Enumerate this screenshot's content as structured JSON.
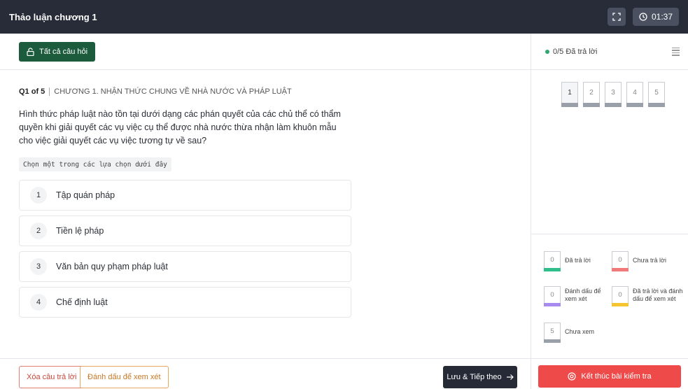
{
  "header": {
    "title": "Thảo luận chương 1",
    "expand_icon": "expand-icon",
    "timer": "01:37",
    "timer_icon": "clock-icon"
  },
  "toolbar": {
    "all_questions_label": "Tất cả câu hỏi",
    "all_questions_icon": "unlock-icon"
  },
  "question": {
    "index_label": "Q1 of 5",
    "chapter": "CHƯƠNG 1. NHẬN THỨC CHUNG VỀ NHÀ NƯỚC VÀ PHÁP LUẬT",
    "text": "Hình thức pháp luật nào tồn tại dưới dạng các phán quyết của các chủ thể có thẩm quyền khi giải quyết các vụ việc cụ thể được nhà nước thừa nhận làm khuôn mẫu cho việc giải quyết các vụ việc tương tự về sau?",
    "hint": "Chọn một trong các lựa chọn dưới đây",
    "options": [
      {
        "num": "1",
        "text": "Tập quán pháp"
      },
      {
        "num": "2",
        "text": "Tiền lệ pháp"
      },
      {
        "num": "3",
        "text": "Văn bản quy phạm pháp luật"
      },
      {
        "num": "4",
        "text": "Chế định luật"
      }
    ]
  },
  "footer": {
    "clear_label": "Xóa câu trả lời",
    "mark_label": "Đánh dấu để xem xét",
    "next_label": "Lưu & Tiếp theo",
    "next_icon": "arrow-right-icon"
  },
  "sidebar": {
    "answered_status": "0/5 Đã trả lời",
    "menu_icon": "menu-icon",
    "question_numbers": [
      "1",
      "2",
      "3",
      "4",
      "5"
    ],
    "current_question": "1",
    "legend": {
      "answered": {
        "count": "0",
        "label": "Đã trả lời",
        "color": "#2fbf8a"
      },
      "not_answered": {
        "count": "0",
        "label": "Chưa trả lời",
        "color": "#f07a7a"
      },
      "marked": {
        "count": "0",
        "label": "Đánh dấu để xem xét",
        "color": "#a98bf0"
      },
      "answered_marked": {
        "count": "0",
        "label": "Đã trả lời và đánh dấu để xem xét",
        "color": "#f4c531"
      },
      "not_viewed": {
        "count": "5",
        "label": "Chưa xem",
        "color": "#9aa0aa"
      }
    },
    "end_label": "Kết thúc bài kiểm tra",
    "end_icon": "target-icon"
  }
}
